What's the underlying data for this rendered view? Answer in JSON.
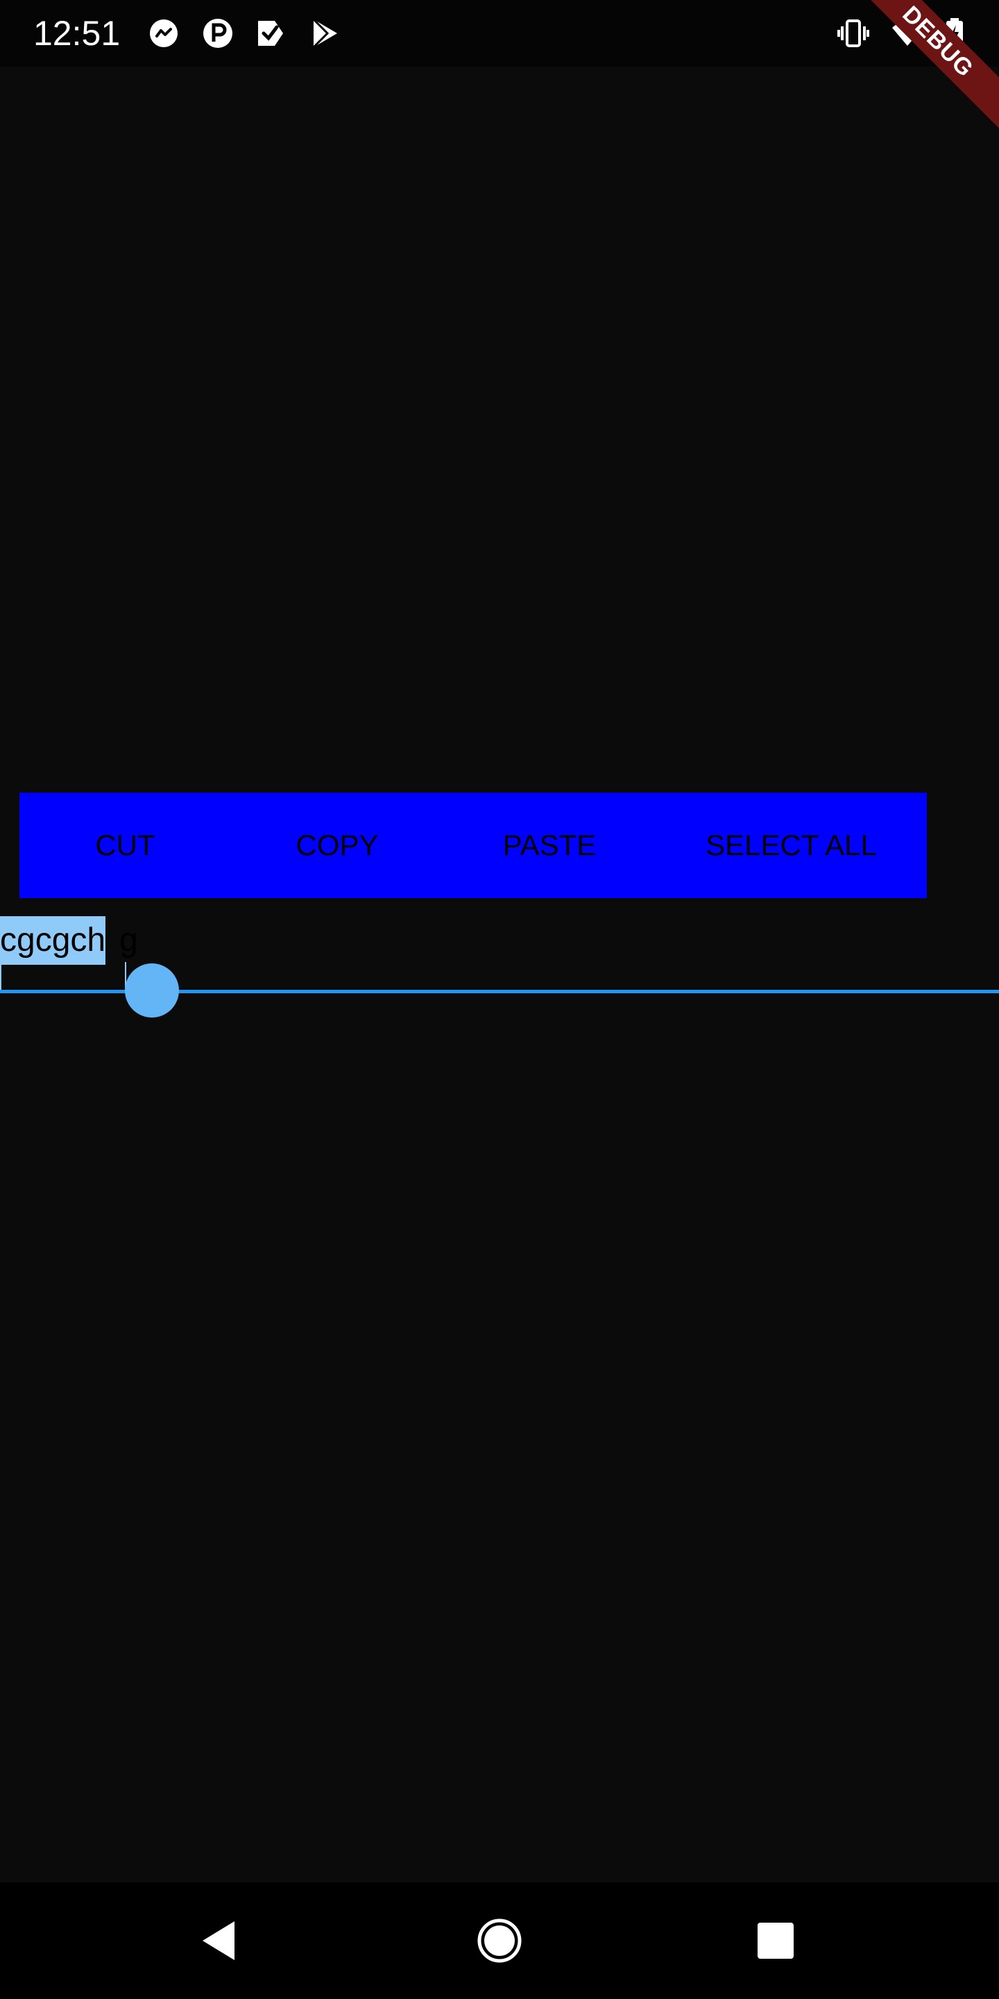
{
  "status_bar": {
    "time": "12:51",
    "left_icons": [
      "messenger-icon",
      "parking-icon",
      "task-check-icon",
      "play-store-icon"
    ],
    "right_icons": [
      "vibrate-icon",
      "wifi-icon",
      "battery-charging-icon"
    ]
  },
  "debug_banner": {
    "label": "DEBUG",
    "color": "#6d1515"
  },
  "toolbar": {
    "background": "#0000ff",
    "cut_label": "CUT",
    "copy_label": "COPY",
    "paste_label": "PASTE",
    "select_all_label": "SELECT ALL"
  },
  "text_field": {
    "selected_text": "cgcgch",
    "unselected_text": "g",
    "accent_color": "#2196f3",
    "selection_color": "#90caf9"
  },
  "nav_bar": {
    "icons": [
      "back-icon",
      "home-icon",
      "recents-icon"
    ]
  }
}
